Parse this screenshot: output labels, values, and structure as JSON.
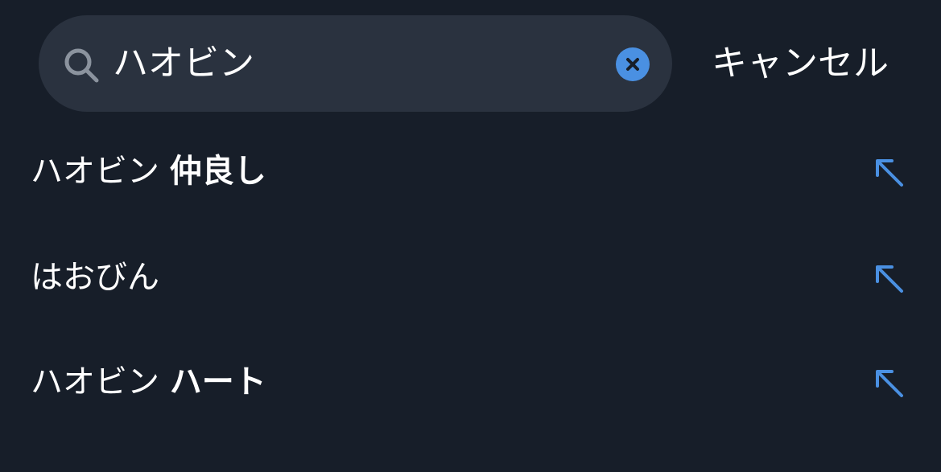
{
  "search": {
    "value": "ハオビン",
    "clear_icon": "close-circle-icon",
    "search_icon": "search-icon"
  },
  "cancel_label": "キャンセル",
  "suggestions": [
    {
      "base": "ハオビン",
      "completion": "仲良し",
      "icon": "arrow-up-left-icon"
    },
    {
      "base": "はおびん",
      "completion": "",
      "icon": "arrow-up-left-icon"
    },
    {
      "base": "ハオビン",
      "completion": "ハート",
      "icon": "arrow-up-left-icon"
    }
  ],
  "colors": {
    "background": "#171e29",
    "search_bar": "#2a323f",
    "accent": "#4a90e2",
    "text": "#ffffff",
    "icon_muted": "#8b939e"
  }
}
